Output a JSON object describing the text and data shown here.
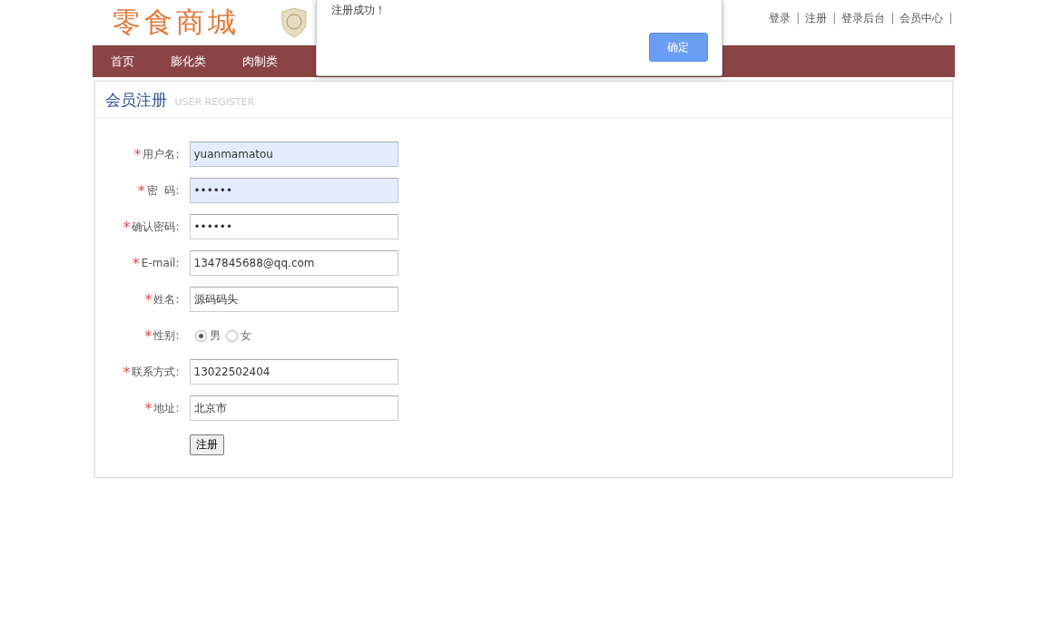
{
  "header": {
    "logo": "零食商城",
    "top_links": [
      "登录",
      "注册",
      "登录后台",
      "会员中心"
    ],
    "separator": "|"
  },
  "nav": {
    "items": [
      "首页",
      "膨化类",
      "肉制类"
    ]
  },
  "panel": {
    "title": "会员注册",
    "subtitle": "USER REGISTER",
    "fields": [
      {
        "kind": "text",
        "mark": "*",
        "label": "用户名:",
        "value": "yuanmamatou",
        "autofilled": true
      },
      {
        "kind": "text",
        "mark": "*",
        "label": "密  码:",
        "value": "••••••",
        "autofilled": true
      },
      {
        "kind": "text",
        "mark": "*",
        "label": "确认密码:",
        "value": "••••••",
        "autofilled": false
      },
      {
        "kind": "text",
        "mark": "*",
        "label": "E-mail:",
        "value": "1347845688@qq.com",
        "autofilled": false
      },
      {
        "kind": "text",
        "mark": "*",
        "label": "姓名:",
        "value": "源码码头",
        "autofilled": false
      },
      {
        "kind": "radio",
        "mark": "*",
        "label": "性别:",
        "options": [
          {
            "label": "男",
            "selected": true
          },
          {
            "label": "女",
            "selected": false
          }
        ]
      },
      {
        "kind": "text",
        "mark": "*",
        "label": "联系方式:",
        "value": "13022502404",
        "autofilled": false
      },
      {
        "kind": "text",
        "mark": "*",
        "label": "地址:",
        "value": "北京市",
        "autofilled": false
      }
    ],
    "submit": "注册"
  },
  "dialog": {
    "message": "注册成功！",
    "button": "确定"
  }
}
